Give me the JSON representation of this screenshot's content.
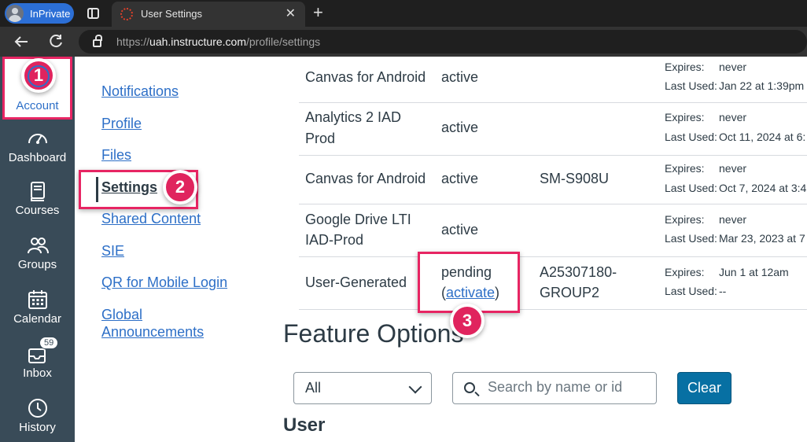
{
  "browser": {
    "inprivate_label": "InPrivate",
    "tab_title": "User Settings",
    "tab_close": "✕",
    "new_tab": "+",
    "url_scheme": "https://",
    "url_host": "uah.instructure.com",
    "url_path": "/profile/settings",
    "icons": [
      "profile-avatar-icon",
      "tab-actions-icon",
      "canvas-favicon",
      "back-arrow-icon",
      "reload-icon",
      "lock-icon"
    ]
  },
  "global_nav": {
    "items": [
      {
        "label": "Account",
        "icon": "user-circle-icon"
      },
      {
        "label": "Dashboard",
        "icon": "speedometer-icon"
      },
      {
        "label": "Courses",
        "icon": "book-icon"
      },
      {
        "label": "Groups",
        "icon": "people-icon"
      },
      {
        "label": "Calendar",
        "icon": "calendar-icon"
      },
      {
        "label": "Inbox",
        "icon": "inbox-icon",
        "badge": "59"
      },
      {
        "label": "History",
        "icon": "clock-icon"
      }
    ]
  },
  "steps": [
    "1",
    "2",
    "3"
  ],
  "section_nav": {
    "items": [
      "Notifications",
      "Profile",
      "Files",
      "Settings",
      "Shared Content",
      "SIE",
      "QR for Mobile Login",
      "Global",
      "Announcements"
    ],
    "active": "Settings"
  },
  "integrations": {
    "rows": [
      {
        "app": "Canvas for Android",
        "status": "active",
        "device": "",
        "expires_label": "Expires:",
        "expires": "never",
        "last_used_label": "Last Used:",
        "last_used": "Jan 22 at 1:39pm"
      },
      {
        "app_line1": "Analytics 2 IAD",
        "app_line2": "Prod",
        "status": "active",
        "device": "",
        "expires_label": "Expires:",
        "expires": "never",
        "last_used_label": "Last Used:",
        "last_used": "Oct 11, 2024 at 6:"
      },
      {
        "app": "Canvas for Android",
        "status": "active",
        "device": "SM-S908U",
        "expires_label": "Expires:",
        "expires": "never",
        "last_used_label": "Last Used:",
        "last_used": "Oct 7, 2024 at 3:4"
      },
      {
        "app_line1": "Google Drive LTI",
        "app_line2": "IAD-Prod",
        "status": "active",
        "device": "",
        "expires_label": "Expires:",
        "expires": "never",
        "last_used_label": "Last Used:",
        "last_used": "Mar 23, 2023 at 7"
      },
      {
        "app": "User-Generated",
        "status": "pending",
        "activate_open": "(",
        "activate_link": "activate",
        "activate_close": ")",
        "device_line1": "A25307180-",
        "device_line2": "GROUP2",
        "expires_label": "Expires:",
        "expires": "Jun 1 at 12am",
        "last_used_label": "Last Used:",
        "last_used": "--"
      }
    ]
  },
  "feature_options": {
    "title": "Feature Options",
    "filter_value": "All",
    "search_placeholder": "Search by name or id",
    "clear_label": "Clear",
    "user_heading": "User"
  },
  "colors": {
    "nav_bg": "#394b58",
    "link": "#2d6fc7",
    "highlight": "#e72563",
    "button": "#0770a3"
  }
}
